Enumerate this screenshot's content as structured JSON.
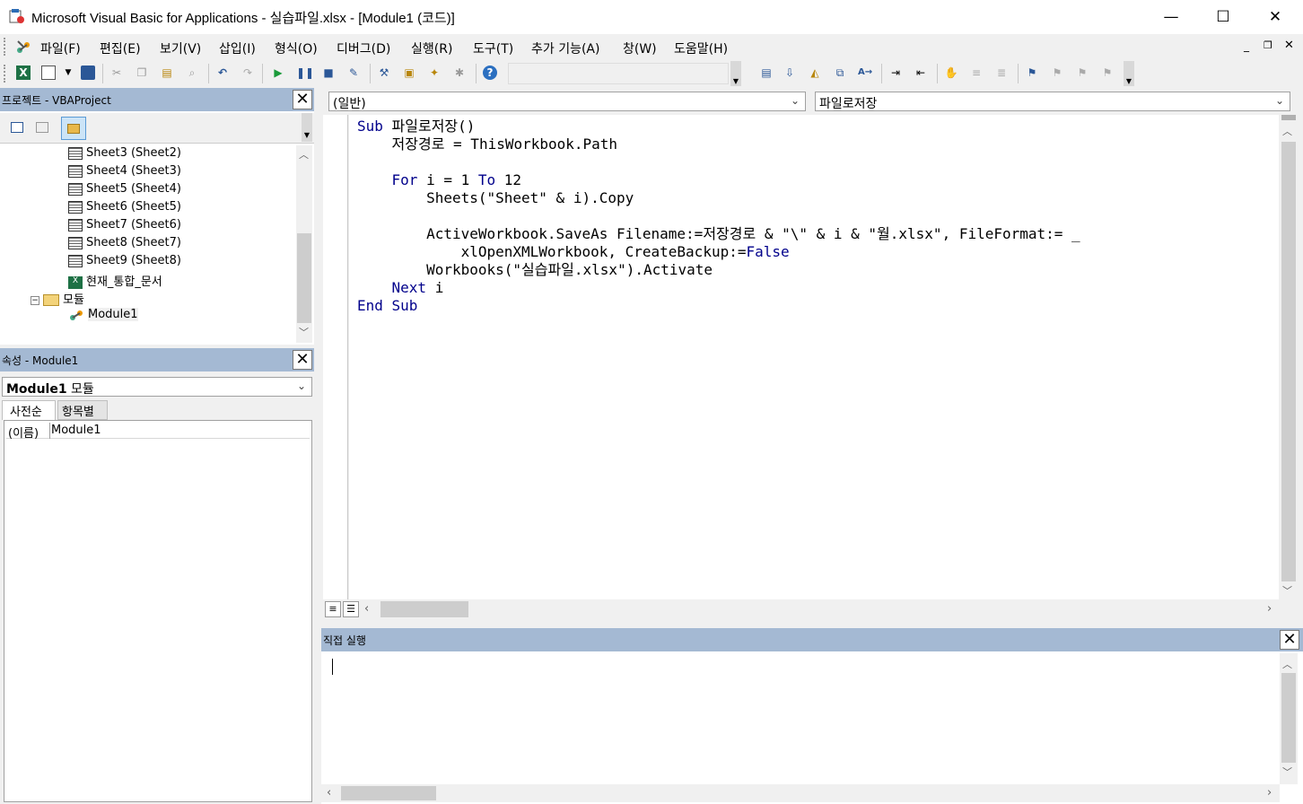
{
  "window": {
    "title": "Microsoft Visual Basic for Applications - 실습파일.xlsx - [Module1 (코드)]",
    "minimize": "—",
    "maximize": "☐",
    "close": "✕"
  },
  "menu": [
    {
      "label": "파일(F)"
    },
    {
      "label": "편집(E)"
    },
    {
      "label": "보기(V)"
    },
    {
      "label": "삽입(I)"
    },
    {
      "label": "형식(O)"
    },
    {
      "label": "디버그(D)"
    },
    {
      "label": "실행(R)"
    },
    {
      "label": "도구(T)"
    },
    {
      "label": "추가 기능(A)"
    },
    {
      "label": "창(W)"
    },
    {
      "label": "도움말(H)"
    }
  ],
  "project_panel": {
    "title": "프로젝트 - VBAProject",
    "items": [
      {
        "label": "Sheet3 (Sheet2)",
        "icon": "sheet-icon"
      },
      {
        "label": "Sheet4 (Sheet3)",
        "icon": "sheet-icon"
      },
      {
        "label": "Sheet5 (Sheet4)",
        "icon": "sheet-icon"
      },
      {
        "label": "Sheet6 (Sheet5)",
        "icon": "sheet-icon"
      },
      {
        "label": "Sheet7 (Sheet6)",
        "icon": "sheet-icon"
      },
      {
        "label": "Sheet8 (Sheet7)",
        "icon": "sheet-icon"
      },
      {
        "label": "Sheet9 (Sheet8)",
        "icon": "sheet-icon"
      },
      {
        "label": "현재_통합_문서",
        "icon": "workbook-icon"
      },
      {
        "label": "모듈",
        "icon": "folder-icon"
      },
      {
        "label": "Module1",
        "icon": "module-icon"
      }
    ]
  },
  "properties_panel": {
    "title": "속성 - Module1",
    "object_name": "Module1",
    "object_type": "모듈",
    "tabs": [
      "사전순",
      "항목별"
    ],
    "rows": [
      {
        "name": "(이름)",
        "value": "Module1"
      }
    ]
  },
  "code_window": {
    "object_combo": "(일반)",
    "proc_combo": "파일로저장",
    "lines": [
      [
        "Sub",
        " 파일로저장()"
      ],
      [
        "",
        "    저장경로 = ThisWorkbook.Path"
      ],
      [
        "",
        ""
      ],
      [
        "For",
        " i = 1 ",
        "To",
        " 12"
      ],
      [
        "",
        "        Sheets(\"Sheet\" & i).Copy"
      ],
      [
        "",
        ""
      ],
      [
        "",
        "        ActiveWorkbook.SaveAs Filename:=저장경로 & \"\\\" & i & \"월.xlsx\", FileFormat:= _"
      ],
      [
        "",
        "            xlOpenXMLWorkbook, CreateBackup:=",
        "False"
      ],
      [
        "",
        "        Workbooks(\"실습파일.xlsx\").Activate"
      ],
      [
        "Next",
        " i"
      ],
      [
        "End Sub",
        ""
      ]
    ]
  },
  "immediate": {
    "title": "직접 실행"
  }
}
